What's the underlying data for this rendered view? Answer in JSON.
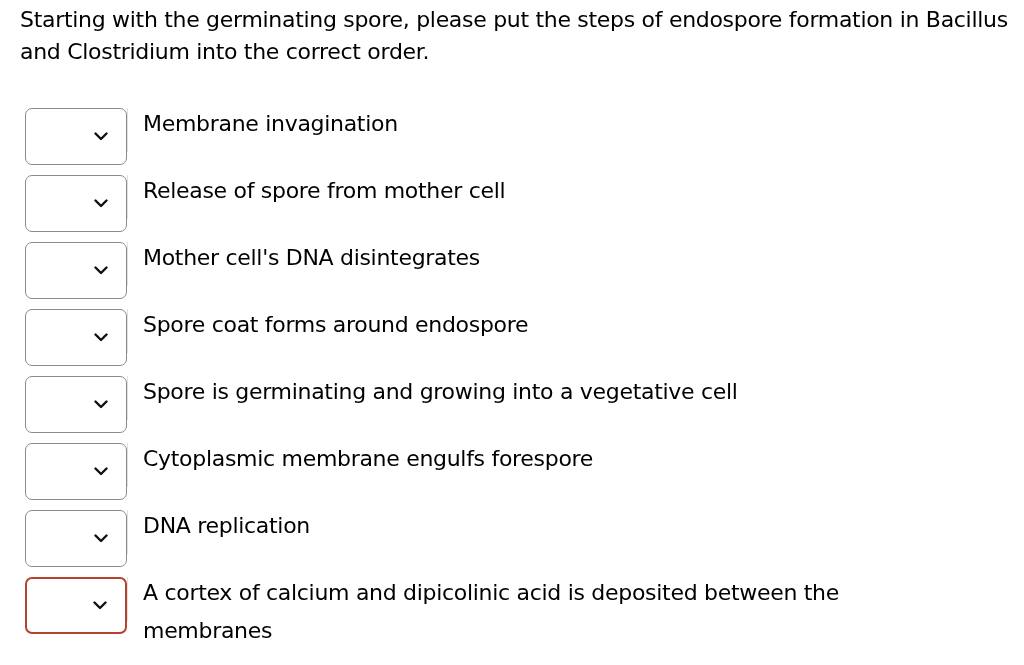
{
  "question": "Starting with the germinating spore, please put the steps of endospore formation in Bacillus and Clostridium into the correct order.",
  "steps": [
    {
      "text": "Membrane invagination",
      "focused": false
    },
    {
      "text": "Release of spore from mother cell",
      "focused": false
    },
    {
      "text": "Mother cell's DNA disintegrates",
      "focused": false
    },
    {
      "text": "Spore coat forms around endospore",
      "focused": false
    },
    {
      "text": "Spore is germinating and growing into a vegetative cell",
      "focused": false
    },
    {
      "text": "Cytoplasmic membrane engulfs forespore",
      "focused": false
    },
    {
      "text": "DNA replication",
      "focused": false
    },
    {
      "text": "A cortex of calcium and dipicolinic acid is deposited between the membranes",
      "focused": true
    }
  ]
}
